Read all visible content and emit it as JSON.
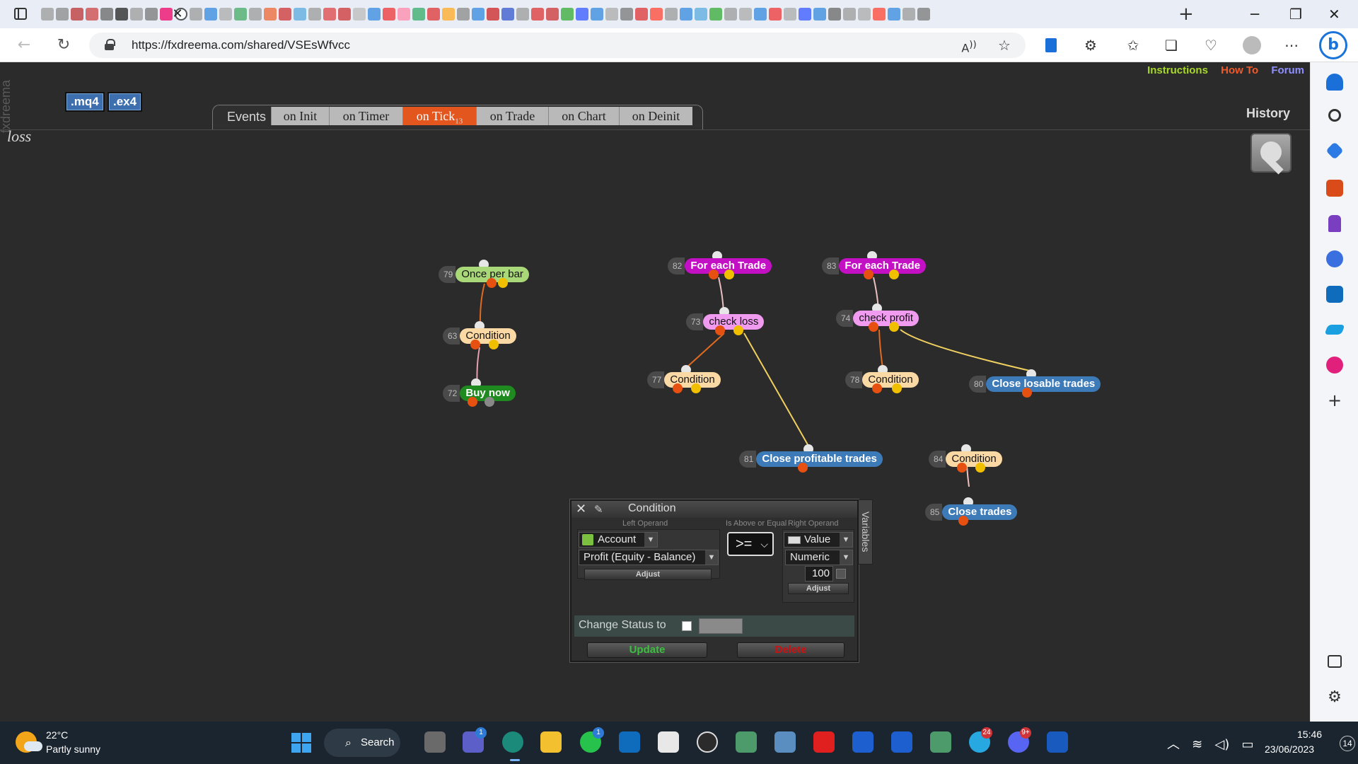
{
  "browser": {
    "url": "https://fxdreema.com/shared/VSEsWfvcc",
    "toolbar_icons": [
      "read-aloud-icon",
      "favorite-star-icon",
      "extension-icon",
      "puzzle-icon",
      "favorites-icon",
      "collections-icon",
      "performance-icon",
      "profile-icon",
      "more-icon"
    ],
    "sidebar_icons": [
      "bell-icon",
      "search-icon",
      "tag-icon",
      "toolbox-icon",
      "chess-icon",
      "office-icon",
      "outlook-icon",
      "send-icon",
      "drop-icon",
      "add-icon",
      "split-icon",
      "settings-icon"
    ]
  },
  "app": {
    "brand": "fxdreema",
    "top_links": {
      "instructions": "Instructions",
      "how_to": "How To",
      "forum": "Forum"
    },
    "top_link_colors": {
      "instructions": "#a8d82a",
      "how_to": "#f15a2b",
      "forum": "#8f8fff"
    },
    "export_buttons": [
      ".mq4",
      ".ex4"
    ],
    "project_name": "loss",
    "history_label": "History",
    "events_label": "Events",
    "event_tabs": [
      {
        "label": "on Init",
        "active": false
      },
      {
        "label": "on Timer",
        "active": false
      },
      {
        "label": "on Tick",
        "badge": "13",
        "active": true
      },
      {
        "label": "on Trade",
        "active": false
      },
      {
        "label": "on Chart",
        "active": false
      },
      {
        "label": "on Deinit",
        "active": false
      }
    ]
  },
  "nodes": [
    {
      "id": "79",
      "label": "Once per bar",
      "color": "#a8d878",
      "text_color": "#111"
    },
    {
      "id": "63",
      "label": "Condition",
      "color": "#fbd9a4",
      "text_color": "#111"
    },
    {
      "id": "72",
      "label": "Buy now",
      "color": "#1f8a1f",
      "text_color": "#ffffff"
    },
    {
      "id": "82",
      "label": "For each Trade",
      "color": "#c410c4",
      "text_color": "#ffffff"
    },
    {
      "id": "73",
      "label": "check loss",
      "color": "#f09af0",
      "text_color": "#111"
    },
    {
      "id": "77",
      "label": "Condition",
      "color": "#fbd9a4",
      "text_color": "#111"
    },
    {
      "id": "83",
      "label": "For each Trade",
      "color": "#c410c4",
      "text_color": "#ffffff"
    },
    {
      "id": "74",
      "label": "check profit",
      "color": "#f09af0",
      "text_color": "#111"
    },
    {
      "id": "78",
      "label": "Condition",
      "color": "#fbd9a4",
      "text_color": "#111"
    },
    {
      "id": "80",
      "label": "Close losable trades",
      "color": "#3d7ab8",
      "text_color": "#ffffff"
    },
    {
      "id": "81",
      "label": "Close profitable trades",
      "color": "#3d7ab8",
      "text_color": "#ffffff"
    },
    {
      "id": "84",
      "label": "Condition",
      "color": "#fbd9a4",
      "text_color": "#111"
    },
    {
      "id": "85",
      "label": "Close trades",
      "color": "#3d7ab8",
      "text_color": "#ffffff"
    }
  ],
  "condition_panel": {
    "title": "Condition",
    "left_operand_header": "Left Operand",
    "operator_header": "Is Above or Equal",
    "right_operand_header": "Right Operand",
    "left_type": "Account",
    "left_value": "Profit (Equity - Balance)",
    "operator": ">=",
    "right_type": "Value",
    "right_subtype": "Numeric",
    "right_number": "100",
    "adjust_label": "Adjust",
    "change_status_label": "Change Status to",
    "update_label": "Update",
    "delete_label": "Delete",
    "variables_tab": "Variables"
  },
  "taskbar": {
    "weather_temp": "22°C",
    "weather_desc": "Partly sunny",
    "search_label": "Search",
    "badges": {
      "teams": "1",
      "whatsapp": "1",
      "telegram": "24",
      "discord": "9+"
    },
    "time": "15:46",
    "date": "23/06/2023",
    "notifications": "14"
  }
}
